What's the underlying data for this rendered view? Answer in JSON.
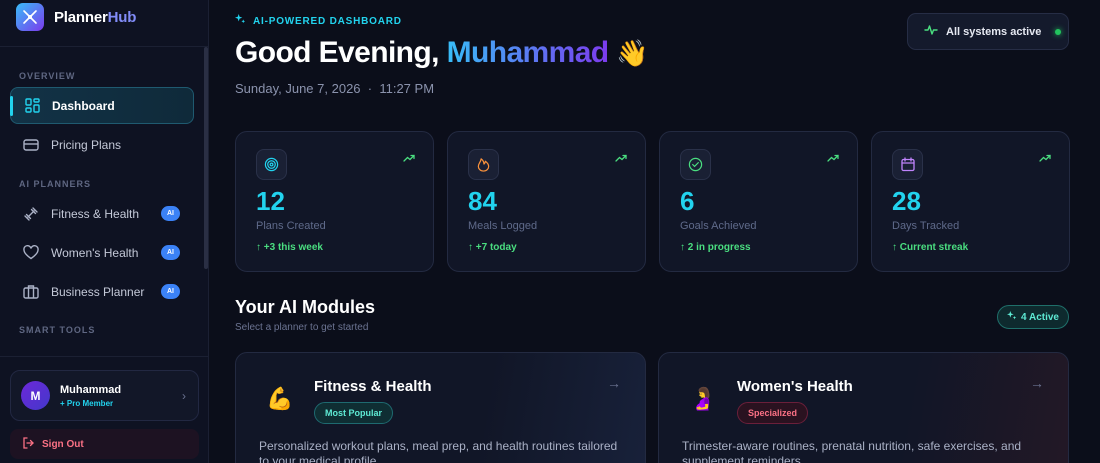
{
  "brand": {
    "name_main": "Planner",
    "name_accent": "Hub"
  },
  "sidebar": {
    "sections": {
      "overview": "OVERVIEW",
      "ai_planners": "AI PLANNERS",
      "smart_tools": "SMART TOOLS"
    },
    "items": [
      {
        "label": "Dashboard",
        "icon": "grid-icon",
        "active": true
      },
      {
        "label": "Pricing Plans",
        "icon": "card-icon"
      },
      {
        "label": "Fitness & Health",
        "icon": "dumbbell-icon",
        "badge": "AI"
      },
      {
        "label": "Women's Health",
        "icon": "heart-icon",
        "badge": "AI"
      },
      {
        "label": "Business Planner",
        "icon": "briefcase-icon",
        "badge": "AI"
      }
    ],
    "user": {
      "initial": "M",
      "name": "Muhammad",
      "role": "+ Pro Member"
    },
    "sign_out": "Sign Out"
  },
  "header": {
    "eyebrow": "AI-POWERED DASHBOARD",
    "greeting": "Good Evening,",
    "name": "Muhammad",
    "wave": "👋",
    "date": "Sunday, June 7, 2026",
    "separator": "·",
    "time": "11:27 PM",
    "status": "All systems active"
  },
  "stats": [
    {
      "value": "12",
      "label": "Plans Created",
      "delta": "↑ +3 this week",
      "icon": "target-icon",
      "icon_color": "#22d3ee"
    },
    {
      "value": "84",
      "label": "Meals Logged",
      "delta": "↑ +7 today",
      "icon": "flame-icon",
      "icon_color": "#fb923c"
    },
    {
      "value": "6",
      "label": "Goals Achieved",
      "delta": "↑ 2 in progress",
      "icon": "check-circle-icon",
      "icon_color": "#4ade80"
    },
    {
      "value": "28",
      "label": "Days Tracked",
      "delta": "↑ Current streak",
      "icon": "calendar-icon",
      "icon_color": "#c084fc"
    }
  ],
  "modules": {
    "title": "Your AI Modules",
    "subtitle": "Select a planner to get started",
    "active_count": "4 Active",
    "cards": [
      {
        "emoji": "💪",
        "title": "Fitness & Health",
        "tag": "Most Popular",
        "desc": "Personalized workout plans, meal prep, and health routines tailored to your medical profile."
      },
      {
        "emoji": "🤰",
        "title": "Women's Health",
        "tag": "Specialized",
        "desc": "Trimester-aware routines, prenatal nutrition, safe exercises, and supplement reminders."
      }
    ]
  }
}
